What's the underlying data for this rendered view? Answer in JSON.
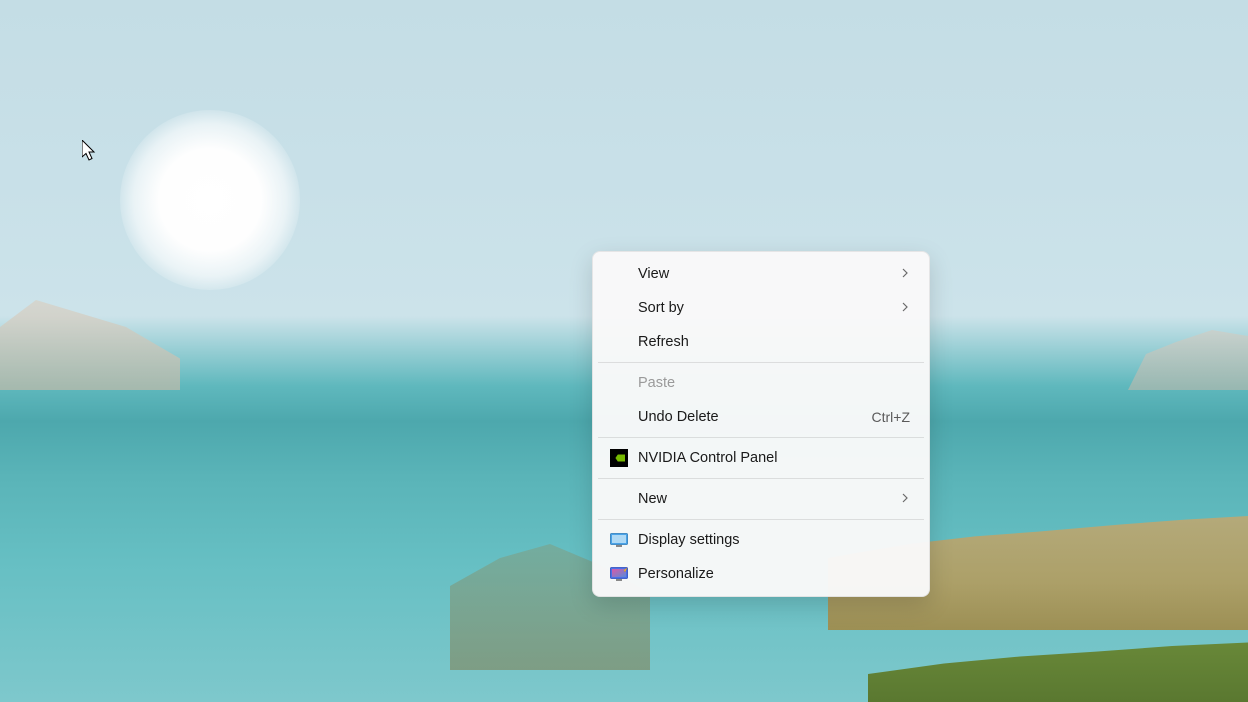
{
  "context_menu": {
    "items": [
      {
        "label": "View",
        "has_submenu": true,
        "icon": null
      },
      {
        "label": "Sort by",
        "has_submenu": true,
        "icon": null
      },
      {
        "label": "Refresh",
        "has_submenu": false,
        "icon": null
      }
    ],
    "items2": [
      {
        "label": "Paste",
        "disabled": true,
        "icon": null
      },
      {
        "label": "Undo Delete",
        "shortcut": "Ctrl+Z",
        "icon": null
      }
    ],
    "items3": [
      {
        "label": "NVIDIA Control Panel",
        "icon": "nvidia"
      }
    ],
    "items4": [
      {
        "label": "New",
        "has_submenu": true,
        "icon": null
      }
    ],
    "items5": [
      {
        "label": "Display settings",
        "icon": "display"
      },
      {
        "label": "Personalize",
        "icon": "personalize"
      }
    ]
  }
}
